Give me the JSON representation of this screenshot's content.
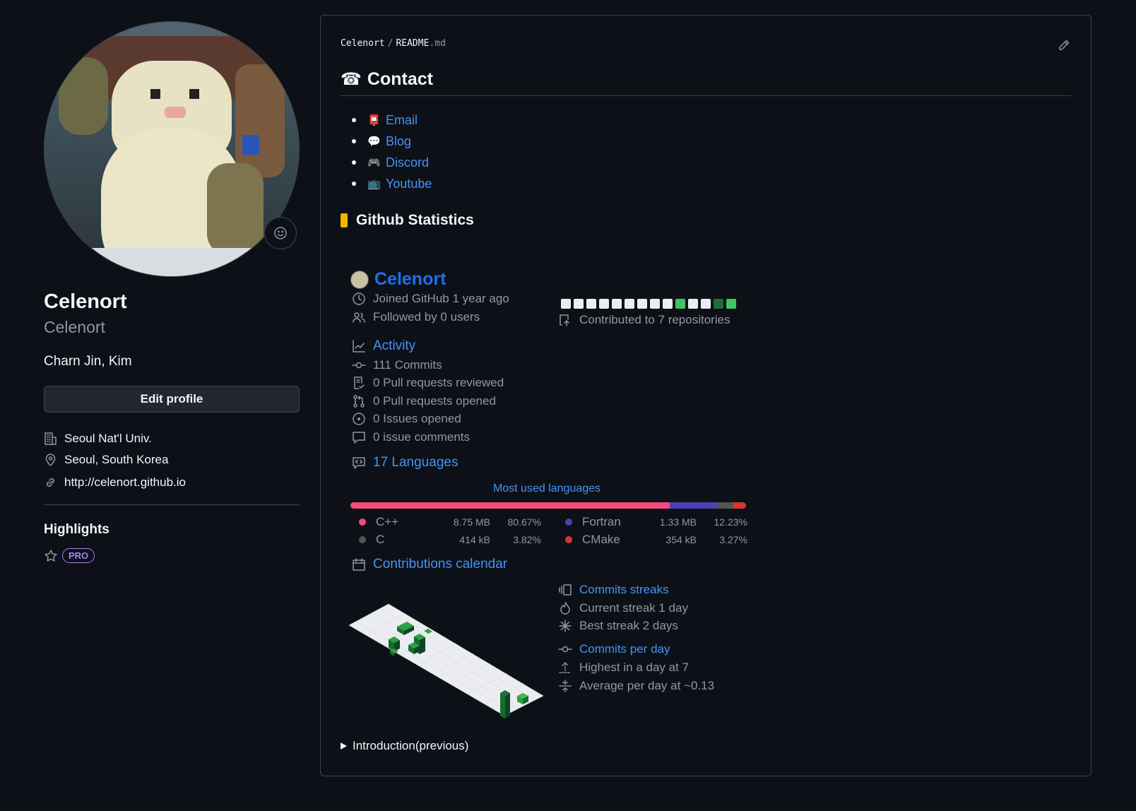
{
  "profile": {
    "display_name": "Celenort",
    "username": "Celenort",
    "bio": "Charn Jin, Kim",
    "edit_button": "Edit profile",
    "organization": "Seoul Nat'l Univ.",
    "location": "Seoul, South Korea",
    "website": "http://celenort.github.io",
    "highlights_title": "Highlights",
    "pro_badge": "PRO"
  },
  "readme": {
    "path_owner": "Celenort",
    "path_sep": "/",
    "path_file": "README",
    "path_ext": ".md",
    "contact_title": "Contact",
    "contact_icon": "☎",
    "contact_links": [
      {
        "emoji": "📮",
        "label": "Email"
      },
      {
        "emoji": "💬",
        "label": "Blog"
      },
      {
        "emoji": "🎮",
        "label": "Discord"
      },
      {
        "emoji": "📺",
        "label": "Youtube"
      }
    ],
    "stats_title": "Github Statistics",
    "details_summary": "Introduction(previous)"
  },
  "metrics": {
    "user": "Celenort",
    "joined": "Joined GitHub 1 year ago",
    "followers": "Followed by 0 users",
    "contributed": "Contributed to 7 repositories",
    "activity_title": "Activity",
    "commits": "111 Commits",
    "pr_reviewed": "0 Pull requests reviewed",
    "pr_opened": "0 Pull requests opened",
    "issues_opened": "0 Issues opened",
    "issue_comments": "0 issue comments",
    "languages_title": "17 Languages",
    "languages_caption": "Most used languages",
    "languages": [
      {
        "name": "C++",
        "size": "8.75 MB",
        "pct": "80.67%",
        "color": "#f34b7d",
        "share": 80.67
      },
      {
        "name": "Fortran",
        "size": "1.33 MB",
        "pct": "12.23%",
        "color": "#4d41b1",
        "share": 12.23
      },
      {
        "name": "C",
        "size": "414 kB",
        "pct": "3.82%",
        "color": "#555555",
        "share": 3.82
      },
      {
        "name": "CMake",
        "size": "354 kB",
        "pct": "3.27%",
        "color": "#da3434",
        "share": 3.27
      }
    ],
    "calendar_title": "Contributions calendar",
    "streaks_title": "Commits streaks",
    "current_streak": "Current streak 1 day",
    "best_streak": "Best streak 2 days",
    "per_day_title": "Commits per day",
    "highest": "Highest in a day at 7",
    "average": "Average per day at ~0.13",
    "recent_days": [
      0,
      0,
      0,
      0,
      0,
      0,
      0,
      0,
      0,
      1,
      0,
      0,
      2,
      1
    ]
  },
  "colors": {
    "accent": "#4493f8",
    "pro": "#ab7df8",
    "stats_bar": "#f5b400",
    "contrib_none": "#ebedf0",
    "contrib_levels": [
      "#40c463",
      "#216e39"
    ]
  }
}
